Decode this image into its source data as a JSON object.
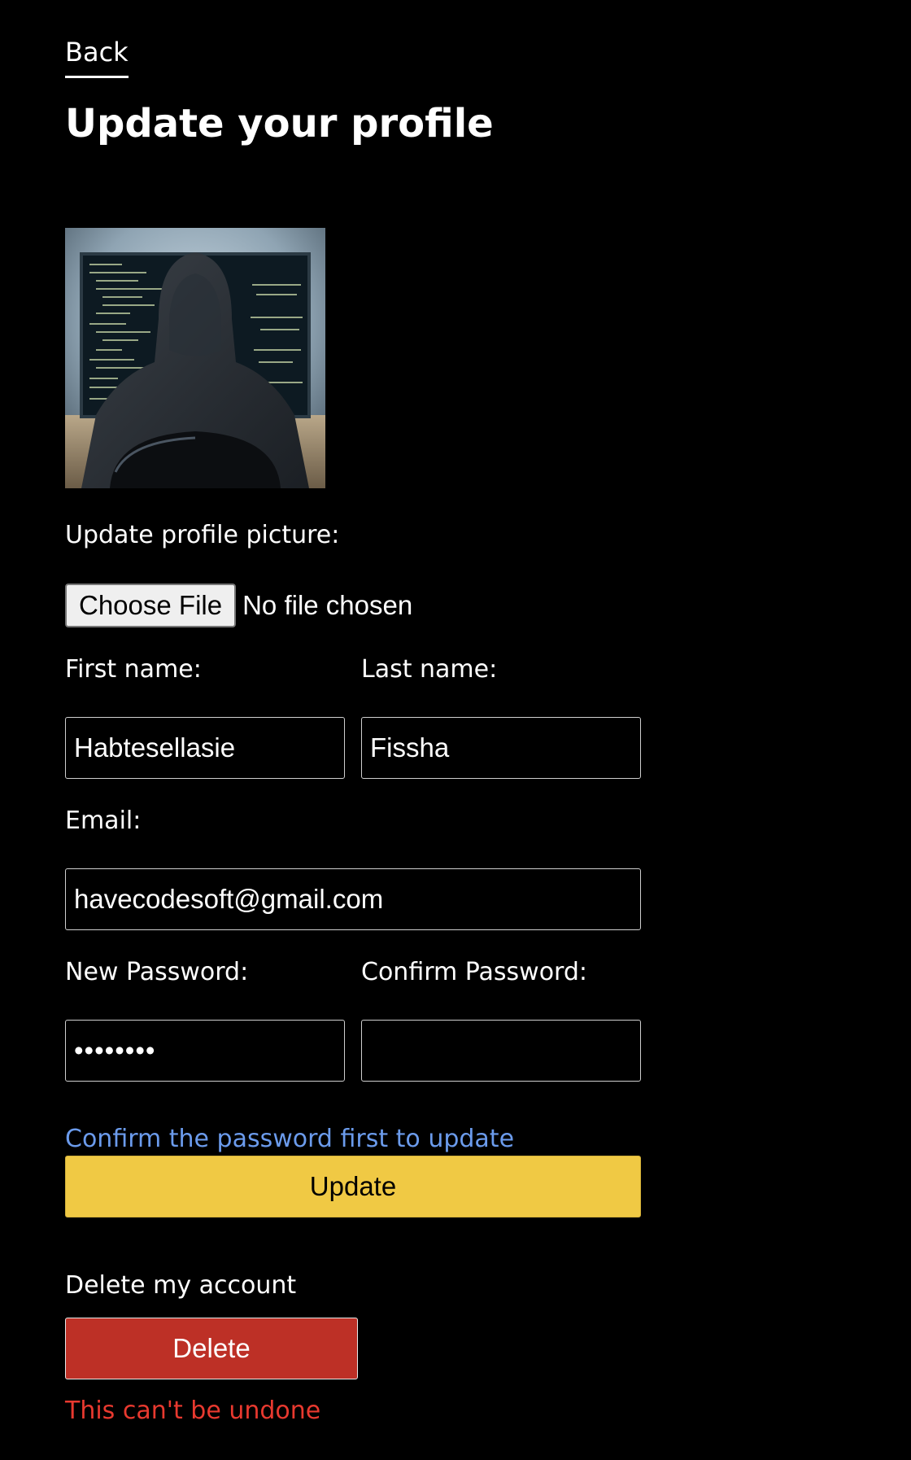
{
  "nav": {
    "back_label": "Back"
  },
  "page": {
    "title": "Update your profile"
  },
  "avatar": {
    "description_icon": "hooded-coder-avatar"
  },
  "picture": {
    "label": "Update profile picture:",
    "choose_label": "Choose File",
    "status": "No file chosen"
  },
  "form": {
    "first_name_label": "First name:",
    "first_name_value": "Habtesellasie",
    "last_name_label": "Last name:",
    "last_name_value": "Fissha",
    "email_label": "Email:",
    "email_value": "havecodesoft@gmail.com",
    "new_password_label": "New Password:",
    "new_password_value": "••••••••",
    "confirm_password_label": "Confirm Password:",
    "confirm_password_value": "",
    "hint": "Confirm the password first to update",
    "update_label": "Update"
  },
  "danger": {
    "label": "Delete my account",
    "delete_label": "Delete",
    "warning": "This can't be undone"
  },
  "colors": {
    "background": "#000000",
    "update_button": "#f0c944",
    "delete_button": "#bd3026",
    "hint_text": "#6b9bec",
    "warning_text": "#e8392f"
  }
}
